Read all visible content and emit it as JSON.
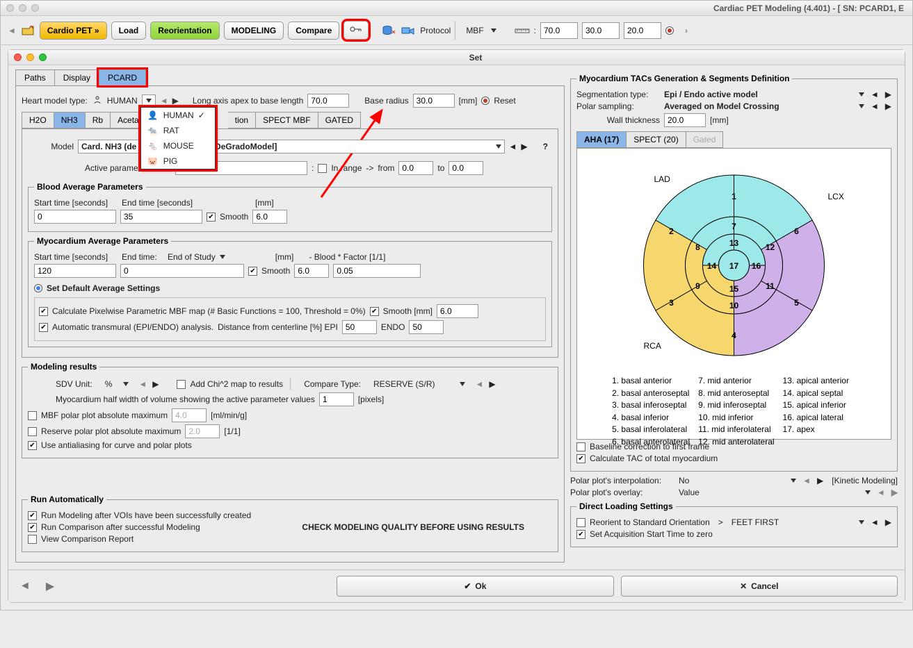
{
  "window": {
    "title": "Cardiac PET Modeling (4.401) - [ SN: PCARD1, E"
  },
  "toolbar": {
    "cardio": "Cardio PET »",
    "load": "Load",
    "reorient": "Reorientation",
    "modeling": "MODELING",
    "compare": "Compare",
    "protocol": "Protocol",
    "mbf": "MBF",
    "dim1": "70.0",
    "dim2": "30.0",
    "dim3": "20.0"
  },
  "inner": {
    "title": "Set"
  },
  "tabs": {
    "paths": "Paths",
    "display": "Display",
    "pcard": "PCARD"
  },
  "heart": {
    "label": "Heart model type:",
    "species": "HUMAN",
    "species_options": {
      "human": "HUMAN",
      "rat": "RAT",
      "mouse": "MOUSE",
      "pig": "PIG"
    },
    "axis_label": "Long axis apex to base length",
    "axis_val": "70.0",
    "base_label": "Base radius",
    "base_val": "30.0",
    "mm": "[mm]",
    "reset": "Reset"
  },
  "tracers": {
    "h2o": "H2O",
    "nh3": "NH3",
    "rb": "Rb",
    "acetate": "Acetate",
    "tion_hidden": "tion",
    "spect": "SPECT MBF",
    "gated": "GATED"
  },
  "model": {
    "label": "Model",
    "name_partial_left": "Card. NH3 (de G",
    "name_partial_right": "I3DeGradoModel]",
    "active_param_label": "Active parameter name",
    "active_param_val": "",
    "inrange": "In range",
    "from": "from",
    "to": "to",
    "from_val": "0.0",
    "to_val": "0.0",
    "q": "?"
  },
  "blood": {
    "legend": "Blood Average Parameters",
    "start_label": "Start time [seconds]",
    "end_label": "End time [seconds]",
    "mm": "[mm]",
    "start_val": "0",
    "end_val": "35",
    "smooth": "Smooth",
    "smooth_val": "6.0"
  },
  "myo": {
    "legend": "Myocardium Average Parameters",
    "start_label": "Start time [seconds]",
    "endtime_label": "End time:",
    "endtime_val": "End of Study",
    "mm": "[mm]",
    "blood_factor": "- Blood * Factor [1/1]",
    "start_val": "120",
    "end_val": "0",
    "smooth": "Smooth",
    "smooth_val": "6.0",
    "factor_val": "0.05",
    "defaults": "Set Default Average Settings",
    "pixelwise": "Calculate Pixelwise Parametric MBF map (# Basic Functions = 100, Threshold = 0%)",
    "smooth_mm": "Smooth [mm]",
    "smooth_mm_val": "6.0",
    "transmural": "Automatic transmural (EPI/ENDO) analysis.",
    "centerline": "Distance from centerline [%] EPI",
    "epi_val": "50",
    "endo": "ENDO",
    "endo_val": "50"
  },
  "results": {
    "legend": "Modeling results",
    "sdv": "SDV Unit:",
    "sdv_val": "%",
    "addchi": "Add Chi^2 map to results",
    "compare_type": "Compare Type:",
    "compare_val": "RESERVE (S/R)",
    "halfwidth": "Myocardium half width of volume showing the active parameter values",
    "halfwidth_val": "1",
    "pixels": "[pixels]",
    "mbf_abs": "MBF polar plot absolute maximum",
    "mbf_val": "4.0",
    "mbf_unit": "[ml/min/g]",
    "reserve_abs": "Reserve polar plot absolute maximum",
    "reserve_val": "2.0",
    "reserve_unit": "[1/1]",
    "aa": "Use antialiasing for curve and polar plots"
  },
  "autorun": {
    "legend": "Run Automatically",
    "run_model": "Run Modeling after VOIs have been successfully created",
    "run_compare": "Run Comparison after successful Modeling",
    "view_report": "View Comparison Report",
    "check": "CHECK MODELING QUALITY BEFORE USING RESULTS"
  },
  "right": {
    "legend": "Myocardium TACs Generation & Segments Definition",
    "seg_type": "Segmentation type:",
    "seg_val": "Epi / Endo active model",
    "polar": "Polar sampling:",
    "polar_val": "Averaged on Model Crossing",
    "wall": "Wall thickness",
    "wall_val": "20.0",
    "mm": "[mm]",
    "tab_aha": "AHA (17)",
    "tab_spect": "SPECT (20)",
    "tab_gated": "Gated",
    "lad": "LAD",
    "lcx": "LCX",
    "rca": "RCA",
    "baseline": "Baseline correction to first frame",
    "calc_tac": "Calculate TAC of total myocardium",
    "interp": "Polar plot's interpolation:",
    "interp_val": "No",
    "kinetic": "[Kinetic Modeling]",
    "overlay": "Polar plot's overlay:",
    "overlay_val": "Value"
  },
  "segments": [
    "1. basal anterior",
    "2. basal anteroseptal",
    "3. basal inferoseptal",
    "4. basal inferior",
    "5. basal inferolateral",
    "6. basal anterolateral",
    "7. mid anterior",
    "8. mid anteroseptal",
    "9. mid inferoseptal",
    "10. mid inferior",
    "11. mid inferolateral",
    "12. mid anterolateral",
    "13. apical anterior",
    "14. apical septal",
    "15. apical inferior",
    "16. apical lateral",
    "17. apex"
  ],
  "direct": {
    "legend": "Direct Loading Settings",
    "reorient": "Reorient to Standard Orientation",
    "gt": ">",
    "feet": "FEET FIRST",
    "zero": "Set Acquisition Start Time to zero"
  },
  "footer": {
    "ok": "Ok",
    "cancel": "Cancel"
  }
}
